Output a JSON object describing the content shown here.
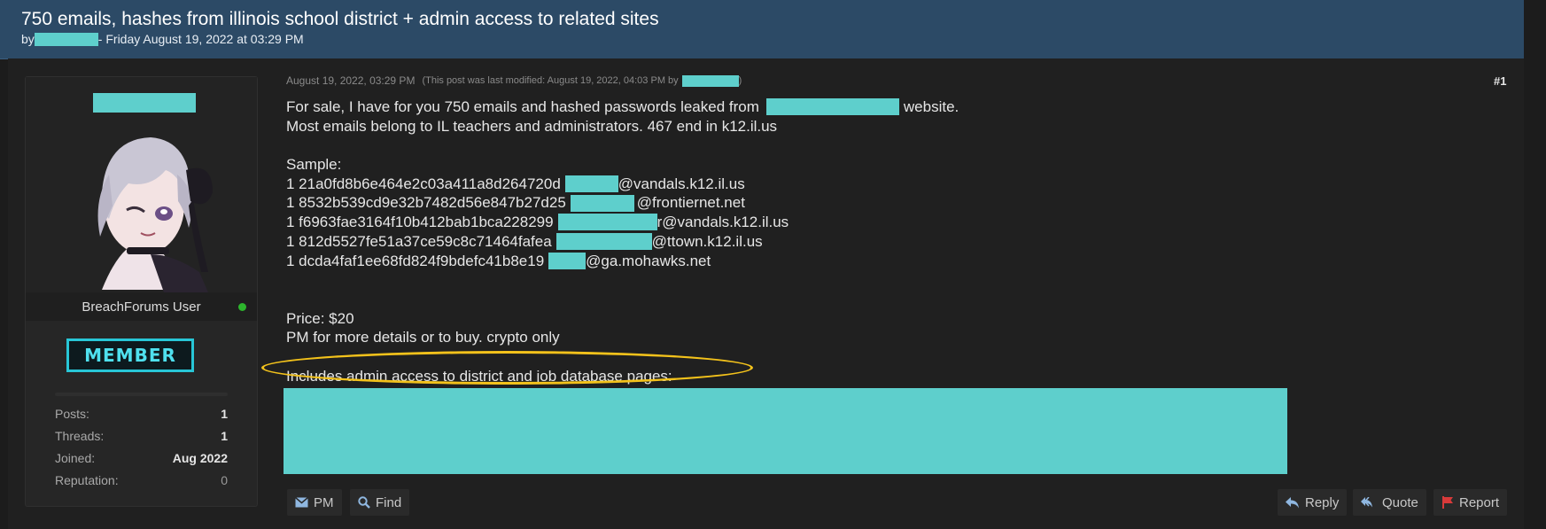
{
  "thread": {
    "title": "750 emails, hashes from illinois school district + admin access to related sites",
    "by_prefix": "by",
    "byline_date": "- Friday August 19, 2022 at 03:29 PM"
  },
  "user": {
    "title": "BreachForums User",
    "badge": "MEMBER",
    "stats": [
      {
        "label": "Posts:",
        "value": "1"
      },
      {
        "label": "Threads:",
        "value": "1"
      },
      {
        "label": "Joined:",
        "value": "Aug 2022"
      },
      {
        "label": "Reputation:",
        "value": "0"
      }
    ]
  },
  "post": {
    "date": "August 19, 2022, 03:29 PM",
    "modified": "(This post was last modified: August 19, 2022, 04:03 PM by",
    "modified_close": ")",
    "number": "#1",
    "lines": {
      "l1a": "For sale, I have for you 750 emails and hashed passwords leaked from",
      "l1b": "website.",
      "l2": "Most emails belong to IL teachers and administrators. 467 end in k12.il.us",
      "sample": "Sample:",
      "s1a": "1 21a0fd8b6e464e2c03a411a8d264720d",
      "s1b": "@vandals.k12.il.us",
      "s2a": "1 8532b539cd9e32b7482d56e847b27d25",
      "s2b": "@frontiernet.net",
      "s3a": "1 f6963fae3164f10b412bab1bca228299",
      "s3b": "r@vandals.k12.il.us",
      "s4a": "1 812d5527fe51a37ce59c8c71464fafea",
      "s4b": "@ttown.k12.il.us",
      "s5a": "1 dcda4faf1ee68fd824f9bdefc41b8e19",
      "s5b": "@ga.mohawks.net",
      "price": "Price: $20",
      "pm": "PM for more details or to buy. crypto only",
      "includes": "Includes admin access to district and job database pages:"
    }
  },
  "buttons": {
    "pm": "PM",
    "find": "Find",
    "reply": "Reply",
    "quote": "Quote",
    "report": "Report"
  },
  "colors": {
    "header_bg": "#2c4a66",
    "redaction": "#5ecfcc",
    "highlight": "#f3c21b",
    "badge": "#28c6d6",
    "report_flag": "#d83a3a"
  }
}
